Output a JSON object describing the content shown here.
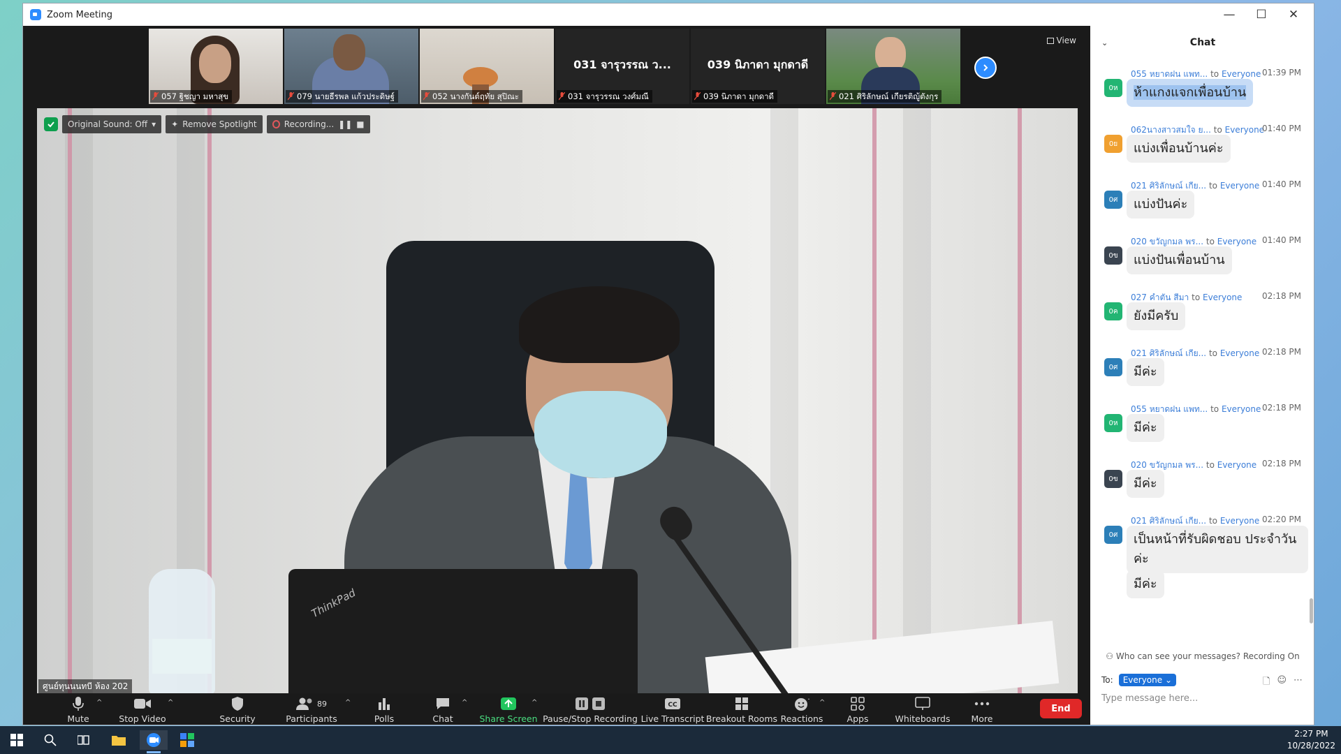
{
  "window": {
    "title": "Zoom Meeting",
    "controls": [
      "—",
      "☐",
      "✕"
    ]
  },
  "participants_strip": {
    "tiles": [
      {
        "name": "057 ฐิชญา มหาสุข",
        "type": "video"
      },
      {
        "name": "079 นายธีรพล แก้วประดิษฐ์",
        "type": "video"
      },
      {
        "name": "052 นางกันต์ฤทัย สุปิณะ",
        "type": "video"
      },
      {
        "name": "031 จารุวรรณ วงศ์มณี",
        "display": "031 จารุวรรณ ว...",
        "type": "name"
      },
      {
        "name": "039 นิภาดา มุกดาดี",
        "display": "039 นิภาดา มุกดาดี",
        "type": "name"
      },
      {
        "name": "021 ศิริลักษณ์ เกียรติญู้ตังกุร",
        "type": "video"
      }
    ],
    "view_label": "View"
  },
  "speaker": {
    "controls": {
      "original_sound": "Original Sound: Off",
      "remove_spotlight": "Remove Spotlight",
      "recording": "Recording..."
    },
    "label": "ศูนย์ทุนนนทบี ห้อง 202",
    "laptop_brand": "ThinkPad"
  },
  "toolbar": {
    "mute": "Mute",
    "stop_video": "Stop Video",
    "security": "Security",
    "participants": "Participants",
    "participants_count": "89",
    "polls": "Polls",
    "chat": "Chat",
    "share_screen": "Share Screen",
    "pause_stop_recording": "Pause/Stop Recording",
    "live_transcript": "Live Transcript",
    "breakout_rooms": "Breakout Rooms",
    "reactions": "Reactions",
    "apps": "Apps",
    "whiteboards": "Whiteboards",
    "more": "More",
    "end": "End",
    "cc": "CC"
  },
  "chat": {
    "title": "Chat",
    "to_word": "to",
    "messages": [
      {
        "sender": "055 หยาดฝน แพท...",
        "to": "Everyone",
        "time": "01:39 PM",
        "avatar": "0ห",
        "avatar_color": "#22b573",
        "text": "ห้าแกงแจกเพื่อนบ้าน",
        "selected": true
      },
      {
        "sender": "062นางสาวสมใจ ย...",
        "to": "Everyone",
        "time": "01:40 PM",
        "avatar": "0ย",
        "avatar_color": "#f0a030",
        "text": "แบ่งเพื่อนบ้านค่ะ"
      },
      {
        "sender": "021 ศิริลักษณ์ เกีย...",
        "to": "Everyone",
        "time": "01:40 PM",
        "avatar": "0ศ",
        "avatar_color": "#2c7fb8",
        "text": "แบ่งปันค่ะ"
      },
      {
        "sender": "020 ขวัญกมล พร...",
        "to": "Everyone",
        "time": "01:40 PM",
        "avatar": "0ข",
        "avatar_color": "#3a4450",
        "text": "แบ่งปันเพื่อนบ้าน"
      },
      {
        "sender": "027 คำตัน สีมา",
        "to": "Everyone",
        "time": "02:18 PM",
        "avatar": "0ค",
        "avatar_color": "#22b573",
        "text": "ยังมีครับ"
      },
      {
        "sender": "021 ศิริลักษณ์ เกีย...",
        "to": "Everyone",
        "time": "02:18 PM",
        "avatar": "0ศ",
        "avatar_color": "#2c7fb8",
        "text": "มีค่ะ"
      },
      {
        "sender": "055 หยาดฝน แพท...",
        "to": "Everyone",
        "time": "02:18 PM",
        "avatar": "0ห",
        "avatar_color": "#22b573",
        "text": "มีค่ะ"
      },
      {
        "sender": "020 ขวัญกมล พร...",
        "to": "Everyone",
        "time": "02:18 PM",
        "avatar": "0ข",
        "avatar_color": "#3a4450",
        "text": "มีค่ะ"
      },
      {
        "sender": "021 ศิริลักษณ์ เกีย...",
        "to": "Everyone",
        "time": "02:20 PM",
        "avatar": "0ศ",
        "avatar_color": "#2c7fb8",
        "text": "เป็นหน้าที่รับผิดชอบ ประจำวันค่ะ",
        "extra": "มีค่ะ"
      }
    ],
    "privacy_note": "Who can see your messages? Recording On",
    "to_label": "To:",
    "to_value": "Everyone",
    "input_placeholder": "Type message here..."
  },
  "taskbar": {
    "time": "2:27 PM",
    "date": "10/28/2022"
  }
}
